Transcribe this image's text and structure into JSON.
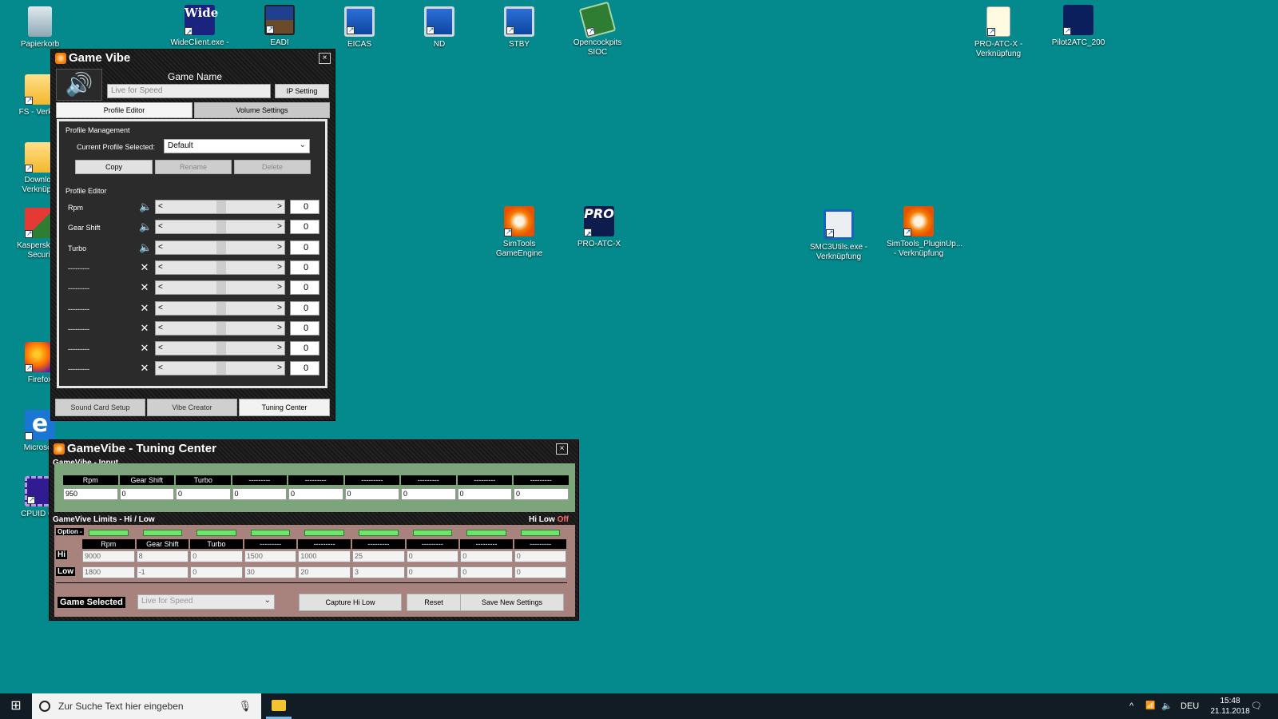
{
  "desktop_icons": [
    {
      "label": "Papierkorb",
      "icon": "recycle-bin-icon"
    },
    {
      "label": "WideClient.exe -",
      "icon": "wideclient-icon",
      "glyph": "Wide"
    },
    {
      "label": "EADI",
      "icon": "eadi-icon"
    },
    {
      "label": "EICAS",
      "icon": "monitor-icon"
    },
    {
      "label": "ND",
      "icon": "monitor-icon"
    },
    {
      "label": "STBY",
      "icon": "monitor-icon"
    },
    {
      "label": "Opencockpits SIOC",
      "icon": "circuit-board-icon"
    },
    {
      "label": "PRO-ATC-X - Verknüpfung",
      "icon": "document-icon"
    },
    {
      "label": "Pilot2ATC_200",
      "icon": "pilot2atc-icon"
    },
    {
      "label": "FS - Verknü",
      "icon": "folder-icon"
    },
    {
      "label": "Downloa Verknüpfu",
      "icon": "folder-icon"
    },
    {
      "label": "Kaspersky In Securit",
      "icon": "kaspersky-icon"
    },
    {
      "label": "Firefox",
      "icon": "firefox-icon"
    },
    {
      "label": "Microsoft",
      "icon": "edge-icon",
      "glyph": "e"
    },
    {
      "label": "CPUID CP",
      "icon": "cpuid-icon"
    },
    {
      "label": "SimTools GameEngine",
      "icon": "simtools-icon"
    },
    {
      "label": "PRO-ATC-X",
      "icon": "pro-atc-icon",
      "glyph": "PRO"
    },
    {
      "label": "SMC3Utils.exe - Verknüpfung",
      "icon": "smc3utils-icon"
    },
    {
      "label": "SimTools_PluginUp... - Verknüpfung",
      "icon": "simtools-plugin-icon"
    }
  ],
  "gamevibe": {
    "title": "Game Vibe",
    "close": "×",
    "speaker_glyph": "🔊",
    "game_name_label": "Game Name",
    "game_name_value": "Live for Speed",
    "ip_setting": "IP Setting",
    "tabs": [
      "Profile Editor",
      "Volume Settings"
    ],
    "profile_management": "Profile Management",
    "current_profile_label": "Current Profile Selected:",
    "current_profile_value": "Default",
    "copy": "Copy",
    "rename": "Rename",
    "delete": "Delete",
    "profile_editor": "Profile Editor",
    "rows": [
      {
        "name": "Rpm",
        "icon": "speaker",
        "glyph": "🔈",
        "value": "0"
      },
      {
        "name": "Gear Shift",
        "icon": "speaker",
        "glyph": "🔈",
        "value": "0"
      },
      {
        "name": "Turbo",
        "icon": "speaker",
        "glyph": "🔈",
        "value": "0"
      },
      {
        "name": "---------",
        "icon": "x",
        "glyph": "✕",
        "value": "0"
      },
      {
        "name": "---------",
        "icon": "x",
        "glyph": "✕",
        "value": "0"
      },
      {
        "name": "---------",
        "icon": "x",
        "glyph": "✕",
        "value": "0"
      },
      {
        "name": "---------",
        "icon": "x",
        "glyph": "✕",
        "value": "0"
      },
      {
        "name": "---------",
        "icon": "x",
        "glyph": "✕",
        "value": "0"
      },
      {
        "name": "---------",
        "icon": "x",
        "glyph": "✕",
        "value": "0"
      }
    ],
    "slider_left": "<",
    "slider_right": ">",
    "bottom_buttons": [
      "Sound Card Setup",
      "Vibe Creator",
      "Tuning Center"
    ]
  },
  "tuning": {
    "title": "GameVibe - Tuning Center",
    "close": "×",
    "input_section": "GameVibe - Input",
    "columns": [
      "Rpm",
      "Gear Shift",
      "Turbo",
      "---------",
      "---------",
      "---------",
      "---------",
      "---------",
      "---------"
    ],
    "input_values": [
      "950",
      "0",
      "0",
      "0",
      "0",
      "0",
      "0",
      "0",
      "0"
    ],
    "limits_section": "GameVive Limits - Hi / Low",
    "hi_label": "Hi",
    "low_label": "Low",
    "off_label": "Off",
    "option_label": "Option -",
    "row_hi": "Hi",
    "row_low": "Low",
    "hi_values": [
      "9000",
      "8",
      "0",
      "1500",
      "1000",
      "25",
      "0",
      "0",
      "0"
    ],
    "low_values": [
      "1800",
      "-1",
      "0",
      "30",
      "20",
      "3",
      "0",
      "0",
      "0"
    ],
    "game_selected_label": "Game Selected",
    "game_selected_value": "Live for Speed",
    "capture": "Capture Hi Low",
    "reset": "Reset",
    "save": "Save New Settings"
  },
  "taskbar": {
    "search_placeholder": "Zur Suche Text hier eingeben",
    "language": "DEU",
    "time": "15:48",
    "date": "21.11.2018",
    "chevron": "^",
    "network": "📶",
    "volume": "🔈",
    "notifications": "🗨"
  }
}
